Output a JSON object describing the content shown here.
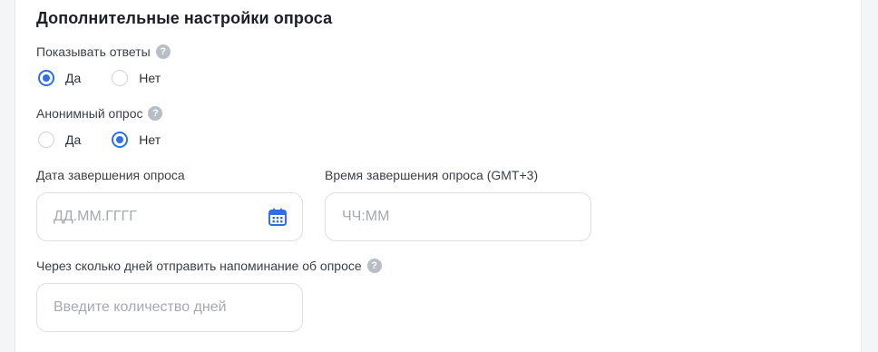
{
  "section_title": "Дополнительные настройки опроса",
  "show_answers": {
    "label": "Показывать ответы",
    "options": [
      {
        "label": "Да",
        "selected": true
      },
      {
        "label": "Нет",
        "selected": false
      }
    ]
  },
  "anonymous": {
    "label": "Анонимный опрос",
    "options": [
      {
        "label": "Да",
        "selected": false
      },
      {
        "label": "Нет",
        "selected": true
      }
    ]
  },
  "end_date": {
    "label": "Дата завершения опроса",
    "placeholder": "ДД.ММ.ГГГГ",
    "value": ""
  },
  "end_time": {
    "label": "Время завершения опроса (GMT+3)",
    "placeholder": "ЧЧ:ММ",
    "value": ""
  },
  "reminder": {
    "label": "Через сколько дней отправить напоминание об опросе",
    "placeholder": "Введите количество дней",
    "value": ""
  },
  "help_glyph": "?",
  "icons": {
    "help": "question-circle-icon",
    "calendar": "calendar-icon"
  },
  "colors": {
    "accent": "#2f6fe6",
    "help_icon": "#b9bec6"
  }
}
